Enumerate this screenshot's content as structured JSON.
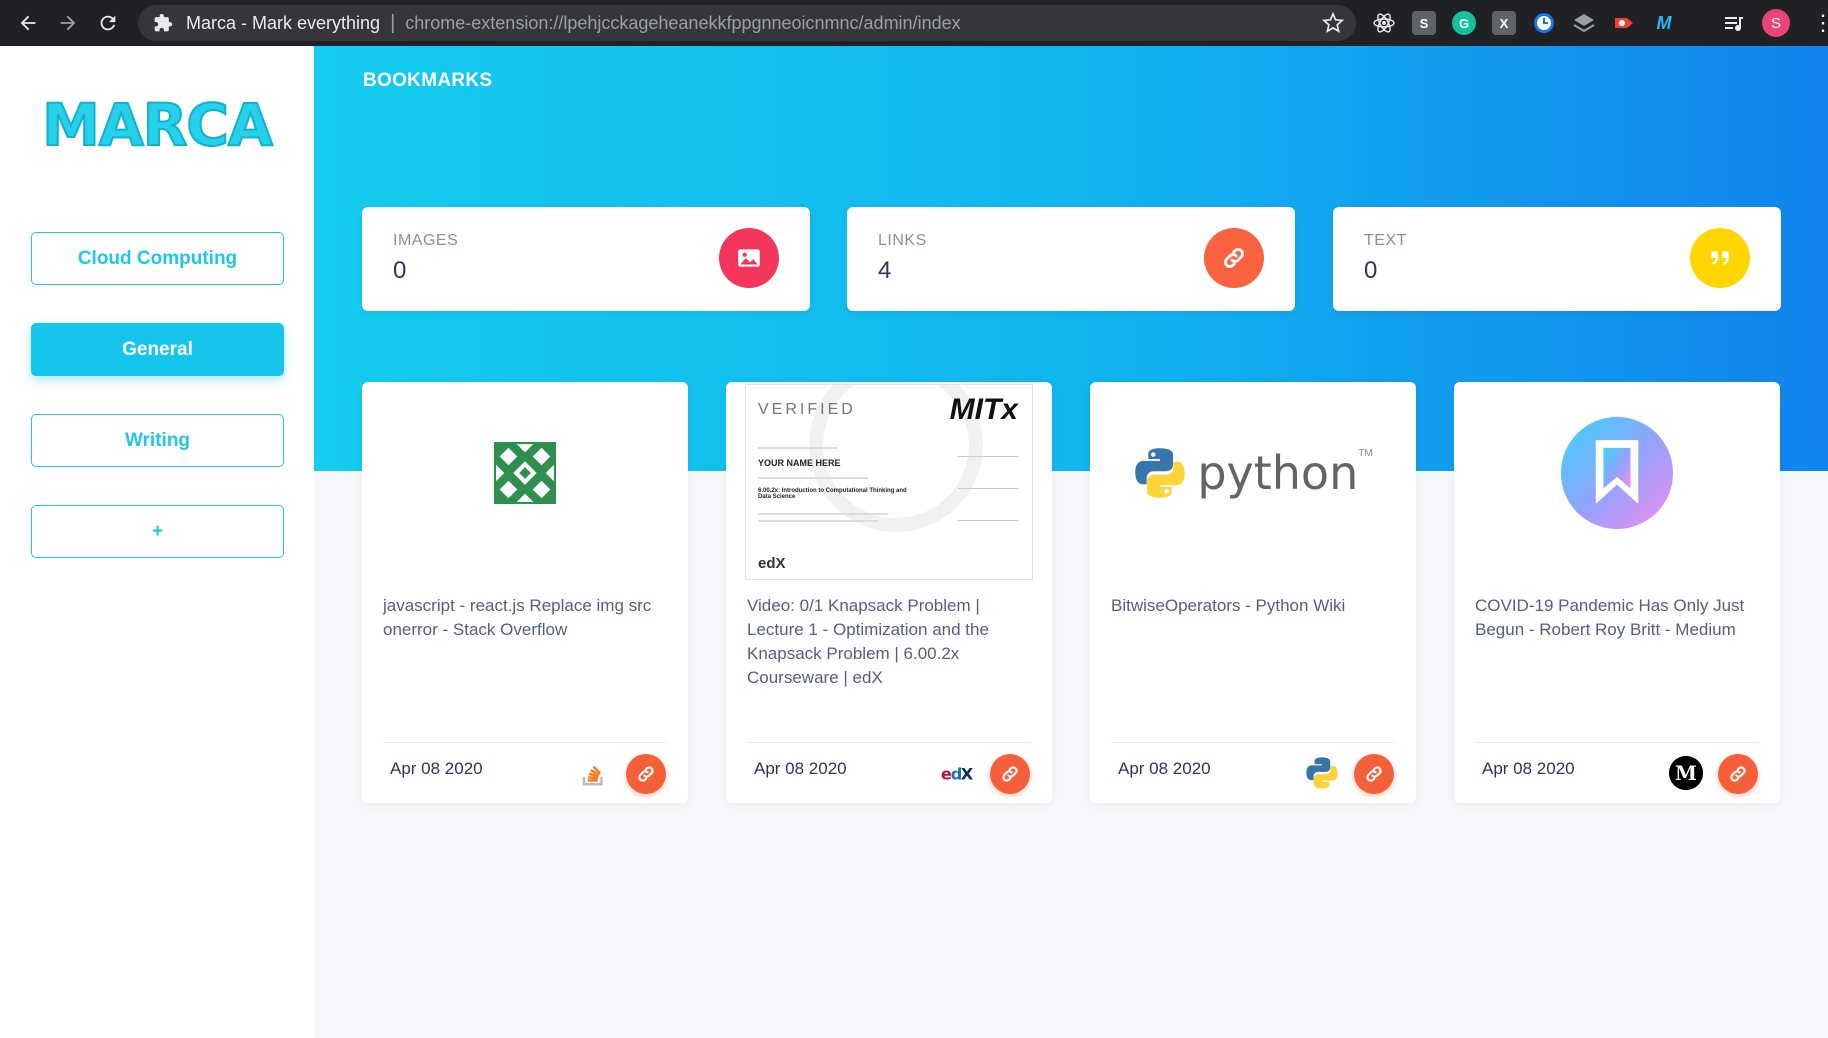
{
  "browser": {
    "tab_title": "Marca - Mark everything",
    "url": "chrome-extension://lpehjcckageheanekkfppgnneoicnmnc/admin/index",
    "profile_initial": "S",
    "extensions": [
      {
        "name": "react-devtools-icon",
        "label": "",
        "color": "#202124"
      },
      {
        "name": "s-extension-icon",
        "label": "S",
        "color": "#5f6368"
      },
      {
        "name": "grammarly-icon",
        "label": "G",
        "color": "#15c39a"
      },
      {
        "name": "x-extension-icon",
        "label": "X",
        "color": "#5f6368"
      },
      {
        "name": "clock-extension-icon",
        "label": "",
        "color": "#1a73e8"
      },
      {
        "name": "layers-extension-icon",
        "label": "",
        "color": "#5f6368"
      },
      {
        "name": "record-extension-icon",
        "label": "",
        "color": "#ea4335"
      },
      {
        "name": "m-extension-icon",
        "label": "M",
        "color": "#1e88e5"
      }
    ]
  },
  "sidebar": {
    "logo": "MARCA",
    "items": [
      {
        "label": "Cloud Computing",
        "active": false
      },
      {
        "label": "General",
        "active": true
      },
      {
        "label": "Writing",
        "active": false
      },
      {
        "label": "+",
        "active": false
      }
    ]
  },
  "main": {
    "title": "BOOKMARKS",
    "stats": [
      {
        "label": "IMAGES",
        "value": "0",
        "icon": "image-icon",
        "color": "#f5365c"
      },
      {
        "label": "LINKS",
        "value": "4",
        "icon": "link-icon",
        "color": "#fb6340"
      },
      {
        "label": "TEXT",
        "value": "0",
        "icon": "quote-icon",
        "color": "#ffd600"
      }
    ],
    "cards": [
      {
        "title": "javascript - react.js Replace img src onerror - Stack Overflow",
        "date": "Apr 08 2020",
        "favicon": "stackoverflow-icon"
      },
      {
        "title": "Video: 0/1 Knapsack Problem | Lecture 1 - Optimization and the Knapsack Problem | 6.00.2x Courseware | edX",
        "date": "Apr 08 2020",
        "favicon": "edx-icon",
        "certificate": {
          "heading": "VERIFIED",
          "brand": "MITx",
          "name": "YOUR NAME HERE",
          "course": "6.00.2x: Introduction to Computational Thinking and Data Science",
          "footer": "edX"
        }
      },
      {
        "title": "BitwiseOperators - Python Wiki",
        "date": "Apr 08 2020",
        "favicon": "python-icon",
        "logo_word": "python",
        "logo_tm": "TM"
      },
      {
        "title": "COVID-19 Pandemic Has Only Just Begun - Robert Roy Britt - Medium",
        "date": "Apr 08 2020",
        "favicon": "medium-icon"
      }
    ]
  }
}
